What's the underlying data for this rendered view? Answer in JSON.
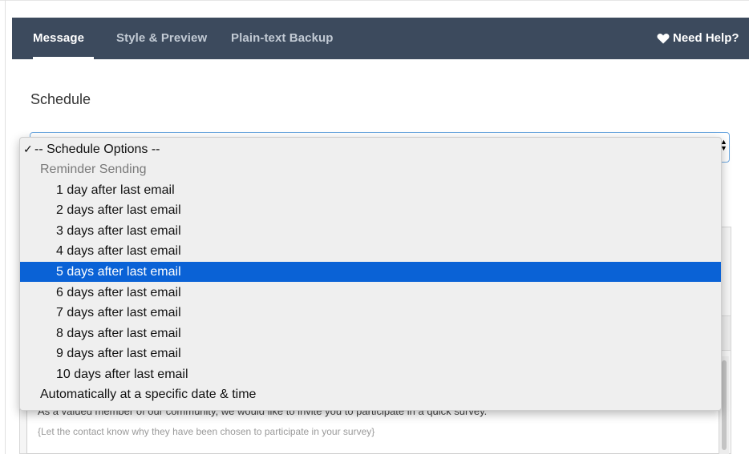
{
  "nav": {
    "tabs": [
      {
        "label": "Message",
        "active": true
      },
      {
        "label": "Style & Preview",
        "active": false
      },
      {
        "label": "Plain-text Backup",
        "active": false
      }
    ],
    "help_label": "Need Help?",
    "help_icon": "heart-icon"
  },
  "schedule": {
    "heading": "Schedule",
    "selected_value": "-- Schedule Options --",
    "options": [
      {
        "label": "-- Schedule Options --",
        "checked": true,
        "kind": "option"
      },
      {
        "label": "Reminder Sending",
        "kind": "group"
      },
      {
        "label": "1 day after last email",
        "kind": "sub"
      },
      {
        "label": "2 days after last email",
        "kind": "sub"
      },
      {
        "label": "3 days after last email",
        "kind": "sub"
      },
      {
        "label": "4 days after last email",
        "kind": "sub"
      },
      {
        "label": "5 days after last email",
        "kind": "sub",
        "highlighted": true
      },
      {
        "label": "6 days after last email",
        "kind": "sub"
      },
      {
        "label": "7 days after last email",
        "kind": "sub"
      },
      {
        "label": "8 days after last email",
        "kind": "sub"
      },
      {
        "label": "9 days after last email",
        "kind": "sub"
      },
      {
        "label": "10 days after last email",
        "kind": "sub"
      },
      {
        "label": "Automatically at a specific date & time",
        "kind": "option"
      }
    ],
    "check_mark": "✓"
  },
  "editor": {
    "body_text": "As a valued member of our community, we would like to invite you to participate in a quick survey.",
    "placeholder_hint": "{Let the contact know why they have been chosen to participate in your survey}"
  },
  "colors": {
    "nav_bg": "#3c4a5d",
    "highlight": "#0a62d6",
    "select_border": "#6ea8e0"
  }
}
